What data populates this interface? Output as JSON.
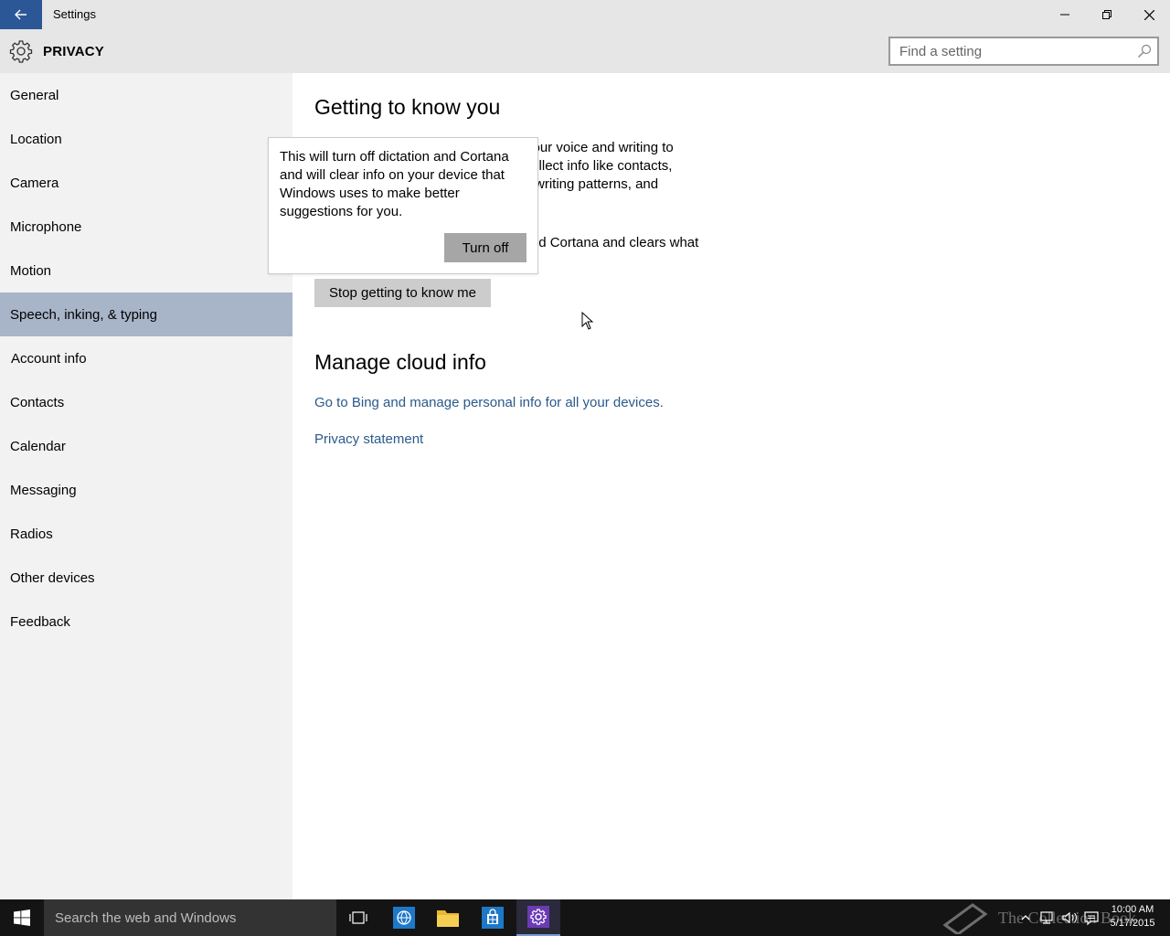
{
  "window": {
    "title": "Settings"
  },
  "header": {
    "title": "PRIVACY",
    "search_placeholder": "Find a setting"
  },
  "sidebar": {
    "items": [
      {
        "label": "General"
      },
      {
        "label": "Location"
      },
      {
        "label": "Camera"
      },
      {
        "label": "Microphone"
      },
      {
        "label": "Motion"
      },
      {
        "label": "Speech, inking, & typing",
        "active": true
      },
      {
        "label": "Account info"
      },
      {
        "label": "Contacts"
      },
      {
        "label": "Calendar"
      },
      {
        "label": "Messaging"
      },
      {
        "label": "Radios"
      },
      {
        "label": "Other devices"
      },
      {
        "label": "Feedback"
      }
    ]
  },
  "main": {
    "section1_title": "Getting to know you",
    "para1_line1": "w your voice and writing to",
    "para1_line2": "'ll collect info like contacts,",
    "para1_line3": "andwriting patterns, and",
    "para2_line1": "n and Cortana and clears what",
    "stop_button": "Stop getting to know me",
    "section2_title": "Manage cloud info",
    "bing_link": "Go to Bing and manage personal info for all your devices.",
    "privacy_link": "Privacy statement"
  },
  "flyout": {
    "text": "This will turn off dictation and Cortana and will clear info on your device that Windows uses to make better suggestions for you.",
    "button": "Turn off"
  },
  "taskbar": {
    "search_placeholder": "Search the web and Windows",
    "watermark": "The Collection Book",
    "time": "10:00 AM",
    "date": "5/17/2015"
  },
  "colors": {
    "accent": "#2b5797",
    "selected_nav": "#a8b4c8",
    "link": "#2a5a8a",
    "chrome": "#e6e6e6",
    "sidebar": "#f2f2f2",
    "taskbar": "#141414"
  }
}
